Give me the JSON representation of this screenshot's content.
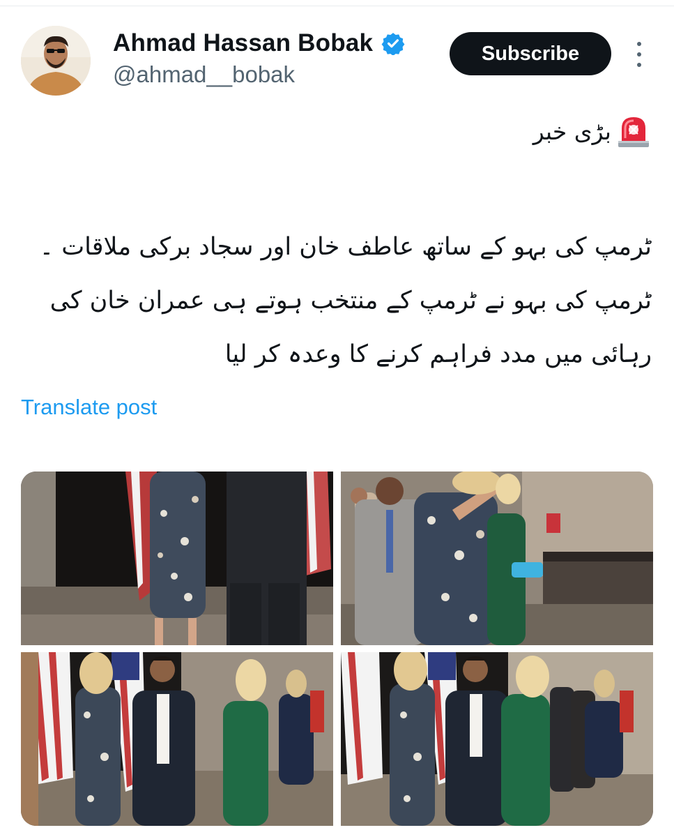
{
  "header": {
    "display_name": "Ahmad Hassan Bobak",
    "handle": "@ahmad__bobak",
    "subscribe_label": "Subscribe"
  },
  "post": {
    "headline": "بڑی خبر",
    "body": "ٹرمپ کی بہو کے ساتھ عاطف خان اور سجاد برکی ملاقات ۔ ٹرمپ کی بہو نے ٹرمپ کے منتخب ہوتے ہی عمران خان کی رہائی میں مدد فراہم کرنے کا وعدہ کر لیا",
    "translate_label": "Translate post"
  },
  "icons": {
    "verified": "verified-badge-icon",
    "more": "more-vertical-icon",
    "siren": "police-light-emoji"
  },
  "colors": {
    "accent": "#1d9bf0",
    "text": "#0f1419",
    "secondary": "#536471",
    "button_bg": "#0f1419"
  },
  "media": {
    "photo_count": 4
  }
}
